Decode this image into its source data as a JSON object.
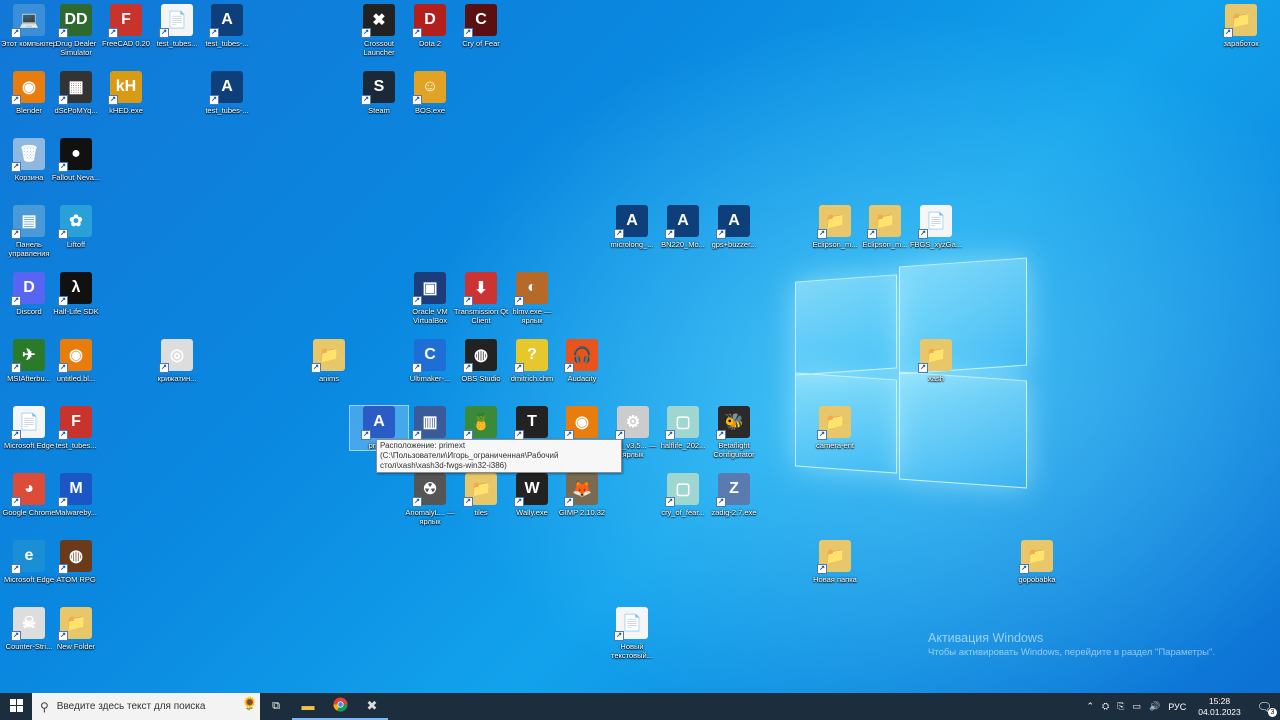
{
  "desktop": {
    "icons": [
      {
        "label": "Этот компьютер",
        "glyph": "💻",
        "color": "#3b8ed8"
      },
      {
        "label": "Drug Dealer Simulator",
        "glyph": "DD",
        "color": "#2e6a2e"
      },
      {
        "label": "FreeCAD 0.20",
        "glyph": "F",
        "color": "#c8342b"
      },
      {
        "label": "test_tubes...",
        "glyph": "📄",
        "color": "#ffffff"
      },
      {
        "label": "test_tubes-...",
        "glyph": "A",
        "color": "#0e3f7a"
      },
      {
        "label": "Crossout Launcher",
        "glyph": "✖",
        "color": "#222222"
      },
      {
        "label": "Dota 2",
        "glyph": "D",
        "color": "#b3201c"
      },
      {
        "label": "Cry of Fear",
        "glyph": "C",
        "color": "#5a1010"
      },
      {
        "label": "заработок",
        "glyph": "📁",
        "color": "#e7c76a"
      },
      {
        "label": "Blender",
        "glyph": "◉",
        "color": "#e87d0d"
      },
      {
        "label": "dScPoMYq...",
        "glyph": "▦",
        "color": "#333333"
      },
      {
        "label": "kHED.exe",
        "glyph": "kH",
        "color": "#d99b16"
      },
      {
        "label": "test_tubes-...",
        "glyph": "A",
        "color": "#0e3f7a"
      },
      {
        "label": "Steam",
        "glyph": "S",
        "color": "#1b2838"
      },
      {
        "label": "BOS.exe",
        "glyph": "☺",
        "color": "#e2a324"
      },
      {
        "label": "Корзина",
        "glyph": "🗑",
        "color": "#8fb8e0"
      },
      {
        "label": "Fallout Neva...",
        "glyph": "●",
        "color": "#111111"
      },
      {
        "label": "microlong_...",
        "glyph": "A",
        "color": "#0e3f7a"
      },
      {
        "label": "BN220_Mo...",
        "glyph": "A",
        "color": "#0e3f7a"
      },
      {
        "label": "gps+buzzer...",
        "glyph": "A",
        "color": "#0e3f7a"
      },
      {
        "label": "Eclipson_m...",
        "glyph": "📁",
        "color": "#e7c76a"
      },
      {
        "label": "Eclipson_m...",
        "glyph": "📁",
        "color": "#e7c76a"
      },
      {
        "label": "FBGS_xyzGa...",
        "glyph": "📄",
        "color": "#ffffff"
      },
      {
        "label": "Панель управления",
        "glyph": "▤",
        "color": "#4a9ad8"
      },
      {
        "label": "Liftoff",
        "glyph": "✿",
        "color": "#2aa0d8"
      },
      {
        "label": "Discord",
        "glyph": "D",
        "color": "#5865f2"
      },
      {
        "label": "Half-Life SDK",
        "glyph": "λ",
        "color": "#111111"
      },
      {
        "label": "Oracle VM VirtualBox",
        "glyph": "▣",
        "color": "#1d3c7a"
      },
      {
        "label": "Transmission Qt Client",
        "glyph": "⬇",
        "color": "#cc3333"
      },
      {
        "label": "hlmv.exe — ярлык",
        "glyph": "◐",
        "color": "#b56a2a"
      },
      {
        "label": "MSIAfterbu...",
        "glyph": "✈",
        "color": "#2a7a2a"
      },
      {
        "label": "untitled.bl...",
        "glyph": "◉",
        "color": "#e87d0d"
      },
      {
        "label": "крижатин...",
        "glyph": "◎",
        "color": "#dddddd"
      },
      {
        "label": "anims",
        "glyph": "📁",
        "color": "#e7c76a"
      },
      {
        "label": "Ultimaker-...",
        "glyph": "C",
        "color": "#1e6ed6"
      },
      {
        "label": "OBS Studio",
        "glyph": "◍",
        "color": "#222222"
      },
      {
        "label": "dmitrich.chm",
        "glyph": "?",
        "color": "#e6c82d"
      },
      {
        "label": "Audacity",
        "glyph": "🎧",
        "color": "#e8541b"
      },
      {
        "label": "xash",
        "glyph": "📁",
        "color": "#e7c76a"
      },
      {
        "label": "Microsoft Edge",
        "glyph": "📄",
        "color": "#ffffff"
      },
      {
        "label": "test_tubes...",
        "glyph": "F",
        "color": "#c8342b"
      },
      {
        "label": "prim...",
        "glyph": "A",
        "color": "#2b5bc4"
      },
      {
        "label": "",
        "glyph": "▥",
        "color": "#3b5a9a"
      },
      {
        "label": "",
        "glyph": "🍍",
        "color": "#3a8a3a"
      },
      {
        "label": "",
        "glyph": "T",
        "color": "#222222"
      },
      {
        "label": "",
        "glyph": "◉",
        "color": "#e87d0d"
      },
      {
        "label": "...ot_v3.5... — ярлык",
        "glyph": "⚙",
        "color": "#cccccc"
      },
      {
        "label": "halflife_202...",
        "glyph": "▢",
        "color": "#9fd7d0"
      },
      {
        "label": "Betaflight Configurator",
        "glyph": "🐝",
        "color": "#2a2a2a"
      },
      {
        "label": "camera-ent",
        "glyph": "📁",
        "color": "#e7c76a"
      },
      {
        "label": "Google Chrome",
        "glyph": "◕",
        "color": "#dd4b39"
      },
      {
        "label": "Malwareby...",
        "glyph": "M",
        "color": "#1a56c4"
      },
      {
        "label": "AnomalyL... — ярлык",
        "glyph": "☢",
        "color": "#555555"
      },
      {
        "label": "tiles",
        "glyph": "📁",
        "color": "#e7c76a"
      },
      {
        "label": "Wally.exe",
        "glyph": "W",
        "color": "#222222"
      },
      {
        "label": "GIMP 2.10.32",
        "glyph": "🦊",
        "color": "#7a6a50"
      },
      {
        "label": "cry_of_fear...",
        "glyph": "▢",
        "color": "#9fd7d0"
      },
      {
        "label": "zadig-2.7.exe",
        "glyph": "Z",
        "color": "#5a7ab0"
      },
      {
        "label": "Microsoft Edge",
        "glyph": "e",
        "color": "#1a8fd6"
      },
      {
        "label": "ATOM RPG",
        "glyph": "◍",
        "color": "#6a3a1a"
      },
      {
        "label": "Новая папка",
        "glyph": "📁",
        "color": "#e7c76a"
      },
      {
        "label": "gopobabka",
        "glyph": "📁",
        "color": "#e7c76a"
      },
      {
        "label": "Counter-Stri...",
        "glyph": "☠",
        "color": "#dddddd"
      },
      {
        "label": "New Folder",
        "glyph": "📁",
        "color": "#e7c76a"
      },
      {
        "label": "Новый текстовый...",
        "glyph": "📄",
        "color": "#ffffff"
      }
    ],
    "tooltip": "Расположение: primext (C:\\Пользователи\\Игорь_ограниченная\\Рабочий стол\\xash\\xash3d-fwgs-win32-i386)",
    "activation_title": "Активация Windows",
    "activation_text": "Чтобы активировать Windows, перейдите в раздел \"Параметры\"."
  },
  "taskbar": {
    "start_icon": "windows-start-icon",
    "search_placeholder": "Введите здесь текст для поиска",
    "tray_lang": "РУС",
    "clock_time": "15:28",
    "clock_date": "04.01.2023",
    "notification_count": "3"
  }
}
